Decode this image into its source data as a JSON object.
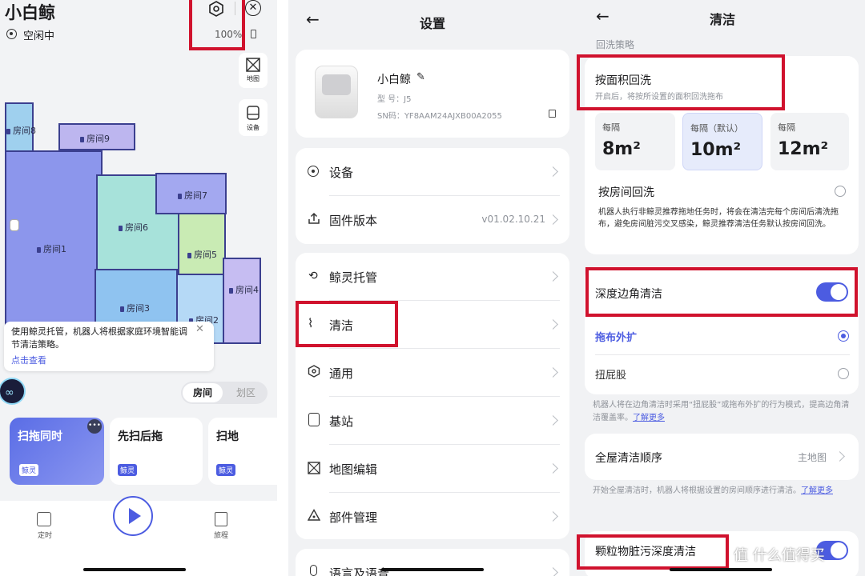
{
  "panel_home": {
    "device_name": "小白鲸",
    "status": "空闲中",
    "battery": "100%",
    "side_buttons": [
      "地图",
      "设备"
    ],
    "rooms": [
      "房间8",
      "房间9",
      "房间7",
      "房间6",
      "房间1",
      "房间5",
      "房间4",
      "房间3",
      "房间2"
    ],
    "tip": {
      "text": "使用鲸灵托管，机器人将根据家庭环境智能调节清洁策略。",
      "link": "点击查看"
    },
    "view_tabs": [
      "房间",
      "划区"
    ],
    "modes": [
      {
        "label": "扫拖同时",
        "badge": "鲸灵"
      },
      {
        "label": "先扫后拖",
        "badge": "鲸灵"
      },
      {
        "label": "扫地",
        "badge": "鲸灵"
      }
    ],
    "bottom_nav": [
      "定时",
      "旅程"
    ]
  },
  "panel_settings": {
    "title": "设置",
    "device": {
      "name": "小白鲸",
      "model": "型 号：J5",
      "sn": "SN码：YF8AAM24AJXB00A2055"
    },
    "group1": [
      {
        "label": "设备",
        "value": ""
      },
      {
        "label": "固件版本",
        "value": "v01.02.10.21"
      }
    ],
    "group2": [
      {
        "label": "鲸灵托管"
      },
      {
        "label": "清洁"
      },
      {
        "label": "通用"
      },
      {
        "label": "基站"
      },
      {
        "label": "地图编辑"
      },
      {
        "label": "部件管理"
      }
    ],
    "group3": [
      {
        "label": "语言及语音"
      }
    ]
  },
  "panel_clean": {
    "title": "清洁",
    "section_label": "回洗策略",
    "area_wash": {
      "title": "按面积回洗",
      "desc": "开启后，将按所设置的面积回洗拖布"
    },
    "area_options": [
      {
        "caption": "每隔",
        "value": "8m²"
      },
      {
        "caption": "每隔（默认）",
        "value": "10m²"
      },
      {
        "caption": "每隔",
        "value": "12m²"
      }
    ],
    "room_wash": {
      "title": "按房间回洗",
      "desc": "机器人执行非鲸灵推荐拖地任务时，将会在清洁完每个房间后清洗拖布，避免房间脏污交叉感染，鲸灵推荐清洁任务默认按房间回洗。"
    },
    "edge_clean": {
      "title": "深度边角清洁"
    },
    "edge_options": [
      "拖布外扩",
      "扭屁股"
    ],
    "edge_desc": "机器人将在边角清洁时采用“扭屁股”或拖布外扩的行为模式，提高边角清洁覆盖率。",
    "learn_more": "了解更多",
    "order": {
      "title": "全屋清洁顺序",
      "value": "主地图"
    },
    "order_desc": "开始全屋清洁时，机器人将根据设置的房间顺序进行清洁。",
    "particle": {
      "title": "颗粒物脏污深度清洁"
    },
    "watermark": "值 什么值得买"
  }
}
